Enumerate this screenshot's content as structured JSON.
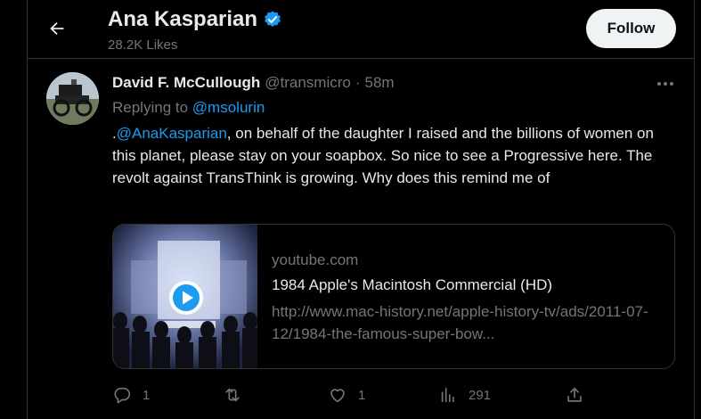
{
  "header": {
    "title": "Ana Kasparian",
    "subtitle": "28.2K Likes",
    "follow_label": "Follow",
    "verified_color": "#1d9bf0"
  },
  "tweet": {
    "author": "David F. McCullough",
    "handle": "@transmicro",
    "separator": "·",
    "time": "58m",
    "replying_prefix": "Replying to",
    "replying_to": "@msolurin",
    "text_prefix": ".",
    "mention": "@AnaKasparian",
    "text_rest": ", on behalf of the daughter I raised and the billions of women on this planet, please stay on your soapbox. So nice to see a Progressive here. The revolt against TransThink is growing. Why does this remind me of",
    "card": {
      "domain": "youtube.com",
      "title": "1984 Apple's Macintosh Commercial (HD)",
      "description": "http://www.mac-history.net/apple-history-tv/ads/2011-07-12/1984-the-famous-super-bow..."
    },
    "actions": {
      "replies": "1",
      "reposts": "",
      "likes": "1",
      "views": "291"
    }
  },
  "colors": {
    "accent": "#1d9bf0",
    "muted": "#71767b",
    "text": "#e7e9ea",
    "border": "#2f3336"
  }
}
